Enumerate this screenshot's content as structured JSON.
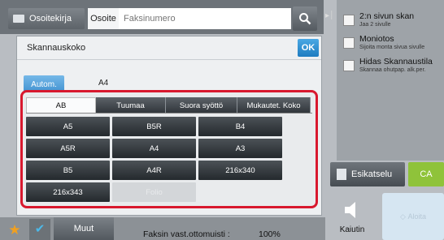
{
  "header": {
    "address_book_label": "Osoitekirja",
    "address_label": "Osoite",
    "fax_placeholder": "Faksinumero"
  },
  "right_panel": {
    "options": [
      {
        "title": "2:n sivun skan",
        "subtitle": "Jaa 2 sivulle"
      },
      {
        "title": "Moniotos",
        "subtitle": "Sijoita monta sivua sivulle"
      },
      {
        "title": "Hidas Skannaustila",
        "subtitle": "Skannaa ohutpap. alk.per."
      }
    ],
    "preview_label": "Esikatselu",
    "ca_label": "CA",
    "speaker_label": "Kaiutin",
    "start_label": "Aloita"
  },
  "bottom": {
    "more_label": "Muut",
    "memory_label": "Faksin vast.ottomuisti",
    "memory_value": "100%"
  },
  "dialog": {
    "title": "Skannauskoko",
    "ok_label": "OK",
    "auto_label": "Autom.",
    "current_size": "A4",
    "tabs": [
      "AB",
      "Tuumaa",
      "Suora syöttö",
      "Mukautet. Koko"
    ],
    "sizes": [
      "A5",
      "B5R",
      "B4",
      "A5R",
      "A4",
      "A3",
      "B5",
      "A4R",
      "216x340",
      "216x343",
      "Folio"
    ]
  },
  "colors": {
    "accent_blue": "#3f91d0",
    "highlight_red": "#d8182e",
    "ca_green": "#8fc33a"
  }
}
